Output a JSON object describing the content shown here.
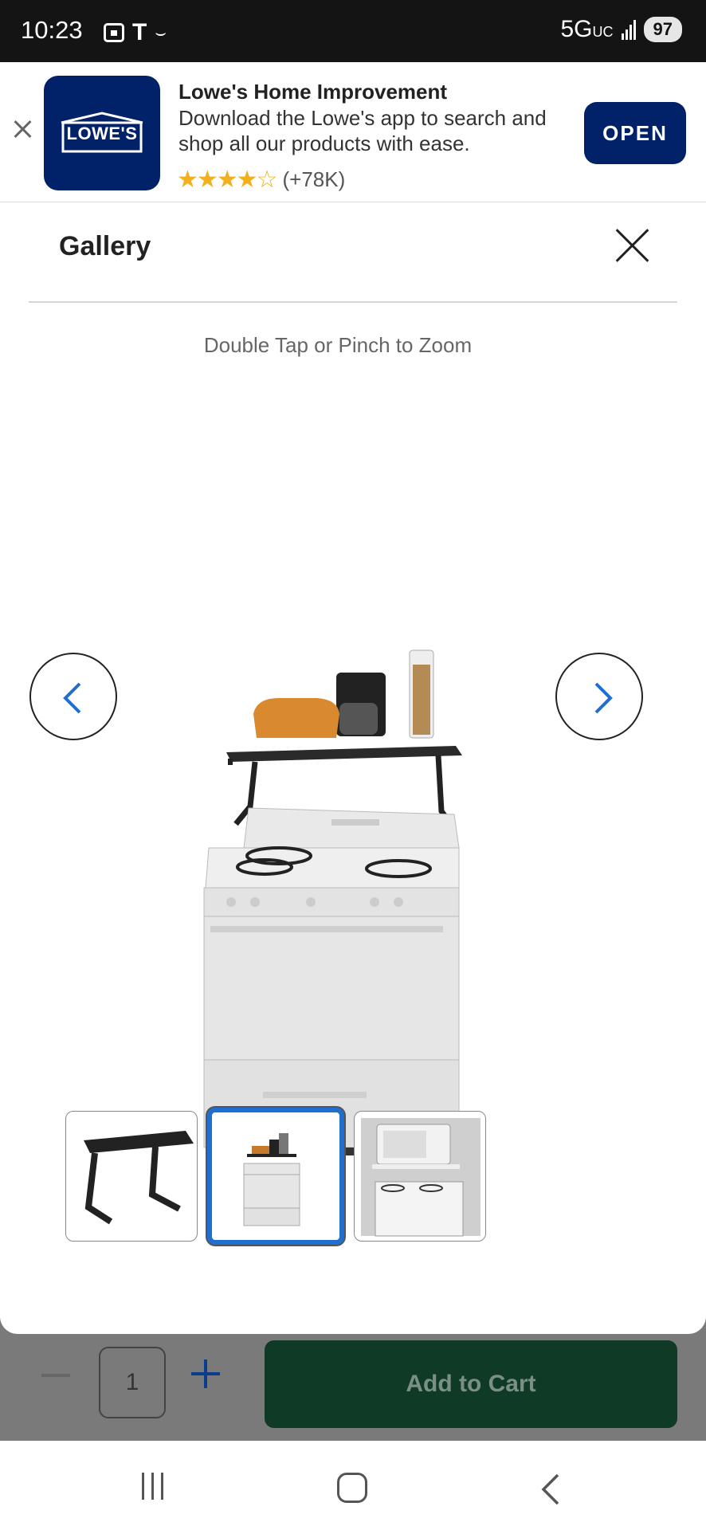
{
  "status_bar": {
    "time": "10:23",
    "network": "5G",
    "network_sub": "UC",
    "battery": "97"
  },
  "app_banner": {
    "title": "Lowe's Home Improvement",
    "description": "Download the Lowe's app to search and shop all our products with ease.",
    "stars": "★★★★☆",
    "rating_count": "(+78K)",
    "open_label": "OPEN",
    "logo_text": "LOWE'S",
    "brand_color": "#012169"
  },
  "gallery": {
    "title": "Gallery",
    "zoom_hint": "Double Tap or Pinch to Zoom",
    "thumbnails": [
      {
        "name": "shelf-only-thumbnail",
        "active": false
      },
      {
        "name": "range-with-shelf-thumbnail",
        "active": true
      },
      {
        "name": "microwave-on-shelf-thumbnail",
        "active": false
      }
    ],
    "accent_color": "#1f6fd1"
  },
  "cart": {
    "quantity": "1",
    "add_label": "Add to Cart"
  }
}
